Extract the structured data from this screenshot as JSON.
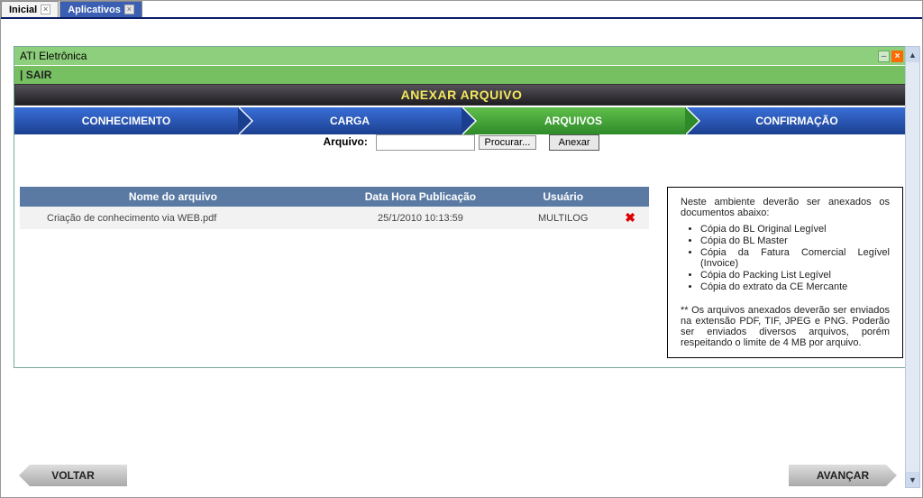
{
  "tabs": [
    {
      "label": "Inicial",
      "active": false
    },
    {
      "label": "Aplicativos",
      "active": true
    }
  ],
  "panel": {
    "title": "ATI Eletrônica",
    "sair": "| SAIR"
  },
  "header_strip": "ANEXAR ARQUIVO",
  "steps": [
    {
      "label": "CONHECIMENTO",
      "style": "blue"
    },
    {
      "label": "CARGA",
      "style": "blue"
    },
    {
      "label": "ARQUIVOS",
      "style": "green"
    },
    {
      "label": "CONFIRMAÇÃO",
      "style": "blue"
    }
  ],
  "upload": {
    "label": "Arquivo:",
    "browse": "Procurar...",
    "anexar": "Anexar"
  },
  "table": {
    "headers": {
      "name": "Nome do arquivo",
      "date": "Data Hora Publicação",
      "user": "Usuário"
    },
    "rows": [
      {
        "name": "Criação de conhecimento via WEB.pdf",
        "date": "25/1/2010 10:13:59",
        "user": "MULTILOG"
      }
    ]
  },
  "info": {
    "intro": "Neste ambiente deverão ser anexados os documentos abaixo:",
    "items": [
      "Cópia do BL Original Legível",
      "Cópia do BL Master",
      "Cópia da Fatura Comercial Legível (Invoice)",
      "Cópia do Packing List Legível",
      "Cópia do extrato da CE Mercante"
    ],
    "note": "** Os arquivos anexados deverão ser enviados na extensão PDF, TIF, JPEG e PNG. Poderão ser enviados diversos arquivos, porém respeitando o limite de 4 MB por arquivo."
  },
  "footer": {
    "back": "VOLTAR",
    "next": "AVANÇAR"
  }
}
